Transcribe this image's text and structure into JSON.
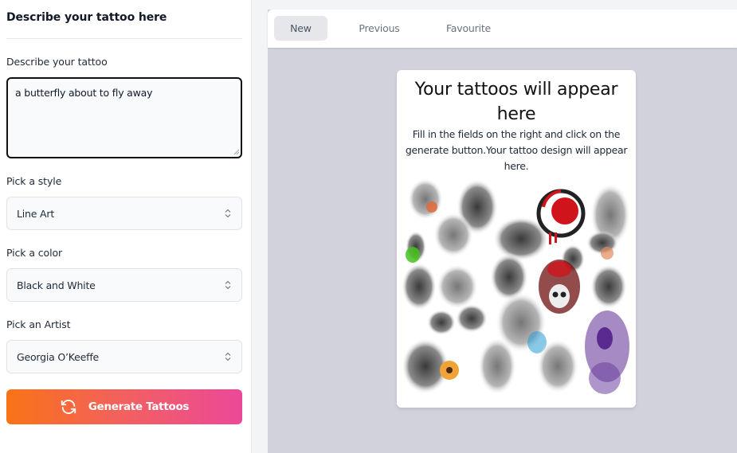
{
  "sidebar": {
    "title": "Describe your tattoo here",
    "description": {
      "label": "Describe your tattoo",
      "value": "a butterfly about to fly away"
    },
    "style": {
      "label": "Pick a style",
      "value": "Line Art"
    },
    "color": {
      "label": "Pick a color",
      "value": "Black and White"
    },
    "artist": {
      "label": "Pick an Artist",
      "value": "Georgia O’Keeffe"
    },
    "generate_button": {
      "label": "Generate Tattoos",
      "icon": "refresh-icon"
    }
  },
  "main": {
    "tabs": [
      {
        "label": "New",
        "active": true
      },
      {
        "label": "Previous",
        "active": false
      },
      {
        "label": "Favourite",
        "active": false
      }
    ],
    "placeholder": {
      "title": "Your tattoos will appear here",
      "subtitle": "Fill in the fields on the right and click on the generate button.Your tattoo design will appear here.",
      "image": "tattoo-collage-sample"
    }
  },
  "colors": {
    "gradient_start": "#f97316",
    "gradient_end": "#ec4899",
    "main_background": "#d1d2db",
    "active_tab": "#e5e7eb"
  }
}
